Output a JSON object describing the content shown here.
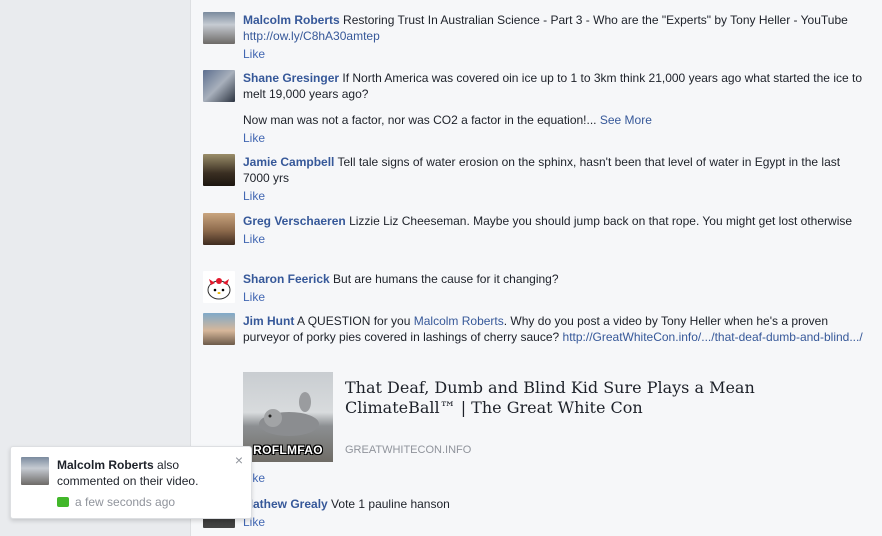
{
  "like_label": "Like",
  "comments": [
    {
      "author": "Malcolm Roberts",
      "text": "Restoring Trust In Australian Science - Part 3 - Who are the \"Experts\" by Tony Heller - YouTube",
      "link": "http://ow.ly/C8hA30amtep"
    },
    {
      "author": "Shane Gresinger",
      "text": "If North America was covered oin ice up to 1 to 3km think 21,000 years ago what started the ice to melt 19,000 years ago?",
      "text2": "Now man was not a factor, nor was CO2 a factor in the equation!...",
      "see_more": "See More"
    },
    {
      "author": "Jamie Campbell",
      "text": "Tell tale signs of water erosion on the sphinx, hasn't been that level of water in Egypt in the last 7000 yrs"
    },
    {
      "author": "Greg Verschaeren",
      "text": "Lizzie Liz Cheeseman. Maybe you should jump back on that rope. You might get lost otherwise"
    },
    {
      "author": "Sharon Feerick",
      "text": "But are humans the cause for it changing?"
    },
    {
      "author": "Jim Hunt",
      "text_a": "A QUESTION for you",
      "mention": "Malcolm Roberts",
      "text_b": ". Why do you post a video by Tony Heller when he's a proven purveyor of porky pies covered in lashings of cherry sauce?",
      "link": "http://GreatWhiteCon.info/.../that-deaf-dumb-and-blind.../",
      "preview": {
        "image_caption": "ROFLMFAO",
        "title": "That Deaf, Dumb and Blind Kid Sure Plays a Mean ClimateBall™ | The Great White Con",
        "domain": "GREATWHITECON.INFO"
      }
    },
    {
      "author": "Mathew Grealy",
      "text": "Vote 1 pauline hanson"
    }
  ],
  "notification": {
    "author": "Malcolm Roberts",
    "text": "also commented on their video.",
    "time": "a few seconds ago",
    "close": "×"
  }
}
